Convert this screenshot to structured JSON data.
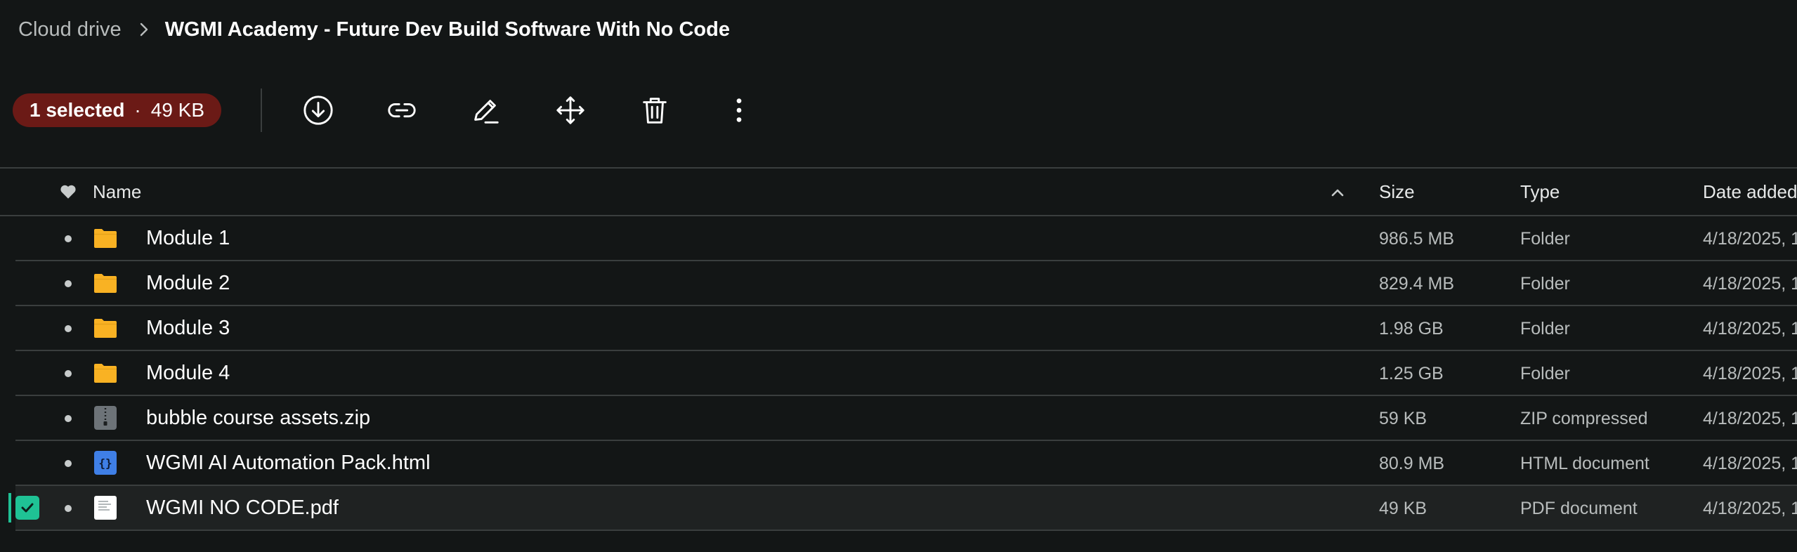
{
  "breadcrumb": {
    "root": "Cloud drive",
    "current": "WGMI Academy - Future Dev Build Software With No Code"
  },
  "selection": {
    "count_label": "1 selected",
    "separator": "·",
    "size_label": "49 KB",
    "pill_color": "#6b1a16"
  },
  "toolbar": {
    "actions": [
      "download-icon",
      "link-icon",
      "rename-icon",
      "move-icon",
      "trash-icon",
      "more-vertical-icon"
    ]
  },
  "table": {
    "columns": {
      "name": "Name",
      "size": "Size",
      "type": "Type",
      "date": "Date added"
    },
    "rows": [
      {
        "icon": "folder-icon",
        "name": "Module 1",
        "size": "986.5 MB",
        "type": "Folder",
        "date": "4/18/2025, 1",
        "selected": false
      },
      {
        "icon": "folder-icon",
        "name": "Module 2",
        "size": "829.4 MB",
        "type": "Folder",
        "date": "4/18/2025, 1",
        "selected": false
      },
      {
        "icon": "folder-icon",
        "name": "Module 3",
        "size": "1.98 GB",
        "type": "Folder",
        "date": "4/18/2025, 1",
        "selected": false
      },
      {
        "icon": "folder-icon",
        "name": "Module 4",
        "size": "1.25 GB",
        "type": "Folder",
        "date": "4/18/2025, 1",
        "selected": false
      },
      {
        "icon": "zip-file-icon",
        "name": "bubble course assets.zip",
        "size": "59 KB",
        "type": "ZIP compressed",
        "date": "4/18/2025, 1",
        "selected": false
      },
      {
        "icon": "code-file-icon",
        "name": "WGMI AI Automation Pack.html",
        "size": "80.9 MB",
        "type": "HTML document",
        "date": "4/18/2025, 1",
        "selected": false
      },
      {
        "icon": "pdf-file-icon",
        "name": "WGMI NO CODE.pdf",
        "size": "49 KB",
        "type": "PDF document",
        "date": "4/18/2025, 1",
        "selected": true
      }
    ]
  },
  "colors": {
    "background": "#131616",
    "accent": "#1fc295",
    "folder": "#f9b223",
    "code_file": "#3f7fe6"
  }
}
